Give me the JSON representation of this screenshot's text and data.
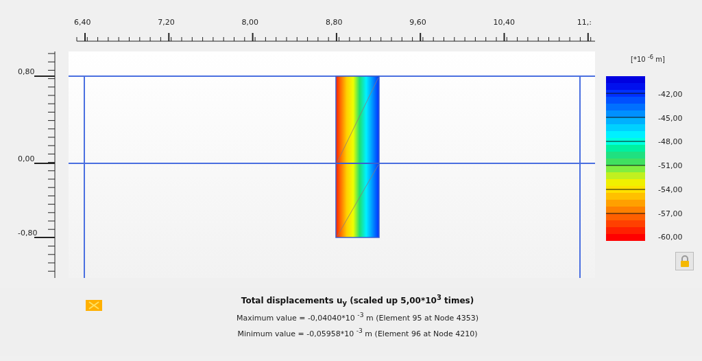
{
  "x_axis": {
    "labels": [
      "6,40",
      "7,20",
      "8,00",
      "8,80",
      "9,60",
      "10,40",
      "11,:"
    ]
  },
  "y_axis": {
    "labels": [
      "0,80",
      "0,00",
      "-0,80"
    ]
  },
  "legend": {
    "unit": "[*10 $^{-6}$ m]",
    "labels": [
      "-42,00",
      "-45,00",
      "-48,00",
      "-51,00",
      "-54,00",
      "-57,00",
      "-60,00"
    ]
  },
  "caption": {
    "title": "Total displacements u$_{y}$ (scaled up 5,00*10$^{3}$ times)",
    "lines": [
      "Maximum value = -0,04040*10 $^{-3}$ m (Element 95 at Node 4353)",
      "Minimum value = -0,05958*10 $^{-3}$ m (Element 96 at Node 4210)"
    ]
  }
}
